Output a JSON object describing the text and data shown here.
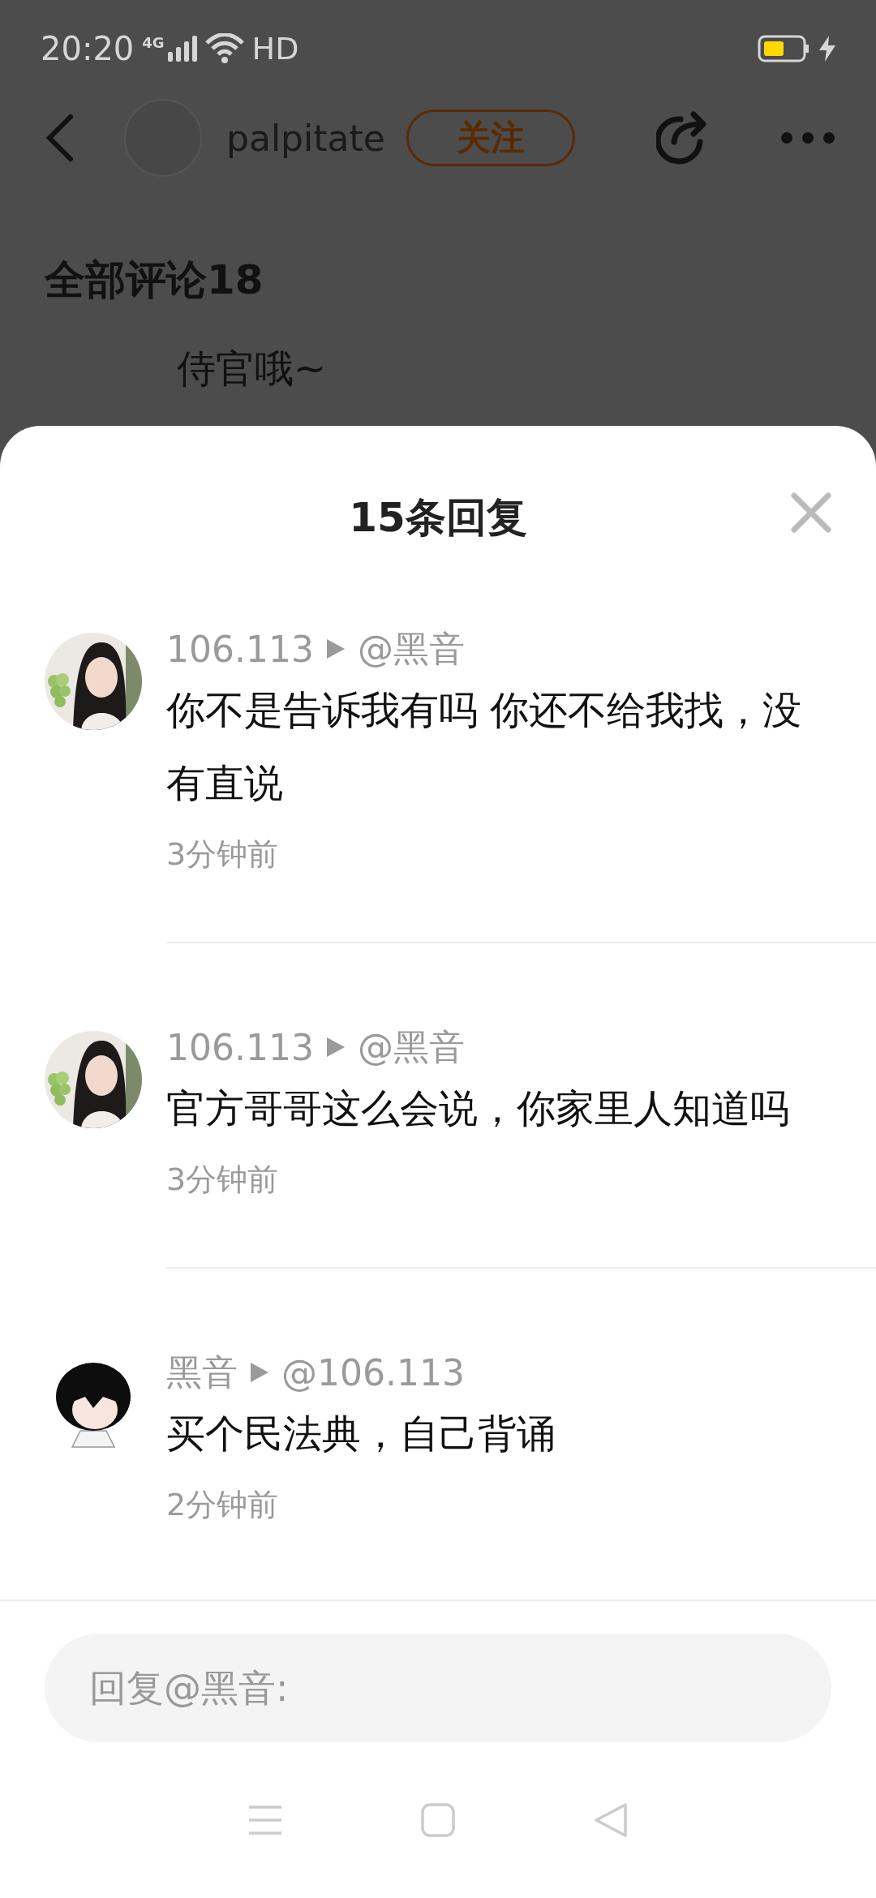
{
  "status_bar": {
    "time": "20:20",
    "network": "4G",
    "connection": "HD",
    "charging": true
  },
  "header": {
    "username": "palpitate",
    "follow_button": "关注"
  },
  "background": {
    "section_title": "全部评论18",
    "comment_text": "侍官哦~"
  },
  "sheet": {
    "title": "15条回复"
  },
  "replies": [
    {
      "author": "106.113",
      "reply_to": "@黑音",
      "text": "你不是告诉我有吗 你还不给我找，没有直说",
      "time": "3分钟前"
    },
    {
      "author": "106.113",
      "reply_to": "@黑音",
      "text": "官方哥哥这么会说，你家里人知道吗",
      "time": "3分钟前",
      "avatar": {
        "kind": "illustration_photo"
      }
    },
    {
      "author": "黑音",
      "reply_to": "@106.113",
      "text": "买个民法典，自己背诵",
      "time": "2分钟前",
      "avatar": {
        "kind": "illustration"
      }
    }
  ],
  "reply_field": {
    "placeholder": "回复@黑音:"
  }
}
